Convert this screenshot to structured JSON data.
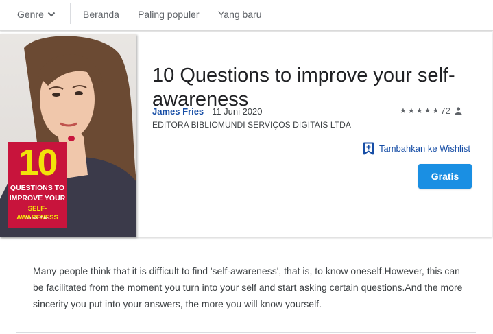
{
  "nav": {
    "genre_label": "Genre",
    "items": [
      "Beranda",
      "Paling populer",
      "Yang baru"
    ]
  },
  "book": {
    "title": "10 Questions to improve your self-awareness",
    "author": "James Fries",
    "date": "11 Juni 2020",
    "publisher": "EDITORA BIBLIOMUNDI SERVIÇOS DIGITAIS LTDA",
    "rating_stars": 4.5,
    "rating_count": "72",
    "wishlist_label": "Tambahkan ke Wishlist",
    "price_button": "Gratis",
    "cover": {
      "number": "10",
      "line1": "QUESTIONS TO",
      "line2": "IMPROVE YOUR",
      "line3": "SELF-AWARENESS",
      "author": "James Fries"
    },
    "description": "Many people think that it is difficult to find 'self-awareness', that is, to know oneself.However, this can be facilitated from the moment you turn into your self and start asking certain questions.And the more sincerity you put into your answers, the more you will know yourself."
  },
  "colors": {
    "accent": "#1a8fe3",
    "link": "#174ea6",
    "cover_badge": "#c8143c",
    "cover_yellow": "#f2e20a"
  },
  "icons": [
    "chevron-down-icon",
    "star-icon",
    "person-icon",
    "bookmark-add-icon"
  ]
}
